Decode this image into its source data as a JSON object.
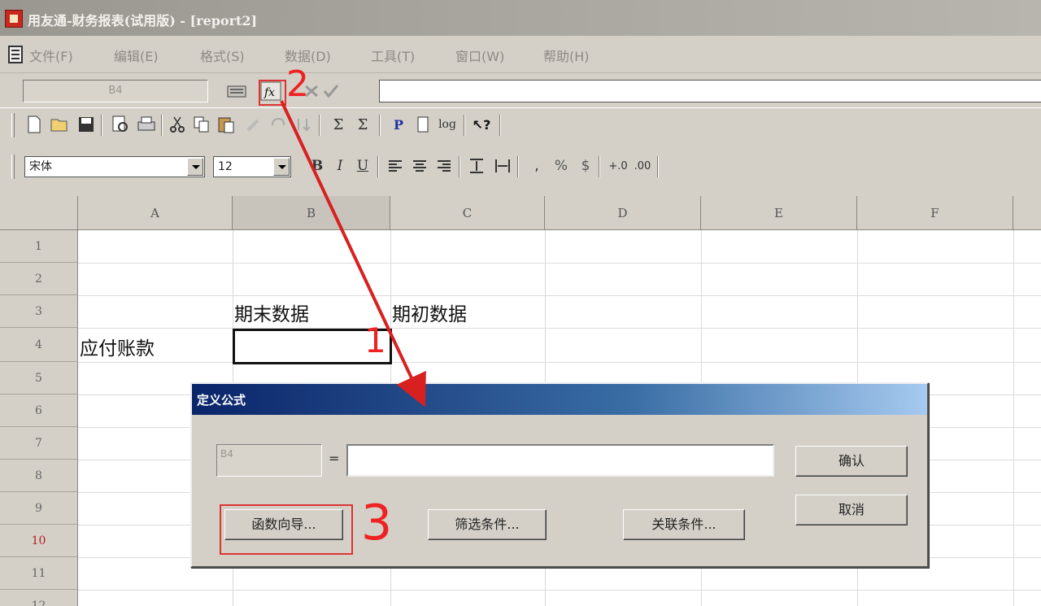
{
  "window": {
    "title": "用友通-财务报表(试用版) - [report2]"
  },
  "menu": {
    "items": [
      "文件(F)",
      "编辑(E)",
      "格式(S)",
      "数据(D)",
      "工具(T)",
      "窗口(W)",
      "帮助(H)"
    ]
  },
  "formula_bar": {
    "cell_ref": "B4",
    "input_value": ""
  },
  "toolbar_font": {
    "font_name": "宋体",
    "font_size": "12"
  },
  "sheet": {
    "columns": [
      "A",
      "B",
      "C",
      "D",
      "E",
      "F"
    ],
    "rows": [
      "1",
      "2",
      "3",
      "4",
      "5",
      "6",
      "7",
      "8",
      "9",
      "10",
      "11",
      "12"
    ],
    "cells": {
      "B3": "期末数据",
      "C3": "期初数据",
      "A4": "应付账款",
      "B4": ""
    }
  },
  "dialog": {
    "title": "定义公式",
    "cell_ref": "B4",
    "equals": "=",
    "formula_value": "",
    "confirm_label": "确认",
    "cancel_label": "取消",
    "function_wizard_label": "函数向导...",
    "filter_label": "筛选条件...",
    "relation_label": "关联条件..."
  },
  "annotations": {
    "step1": "1",
    "step2": "2",
    "step3": "3",
    "color": "#e02020"
  }
}
